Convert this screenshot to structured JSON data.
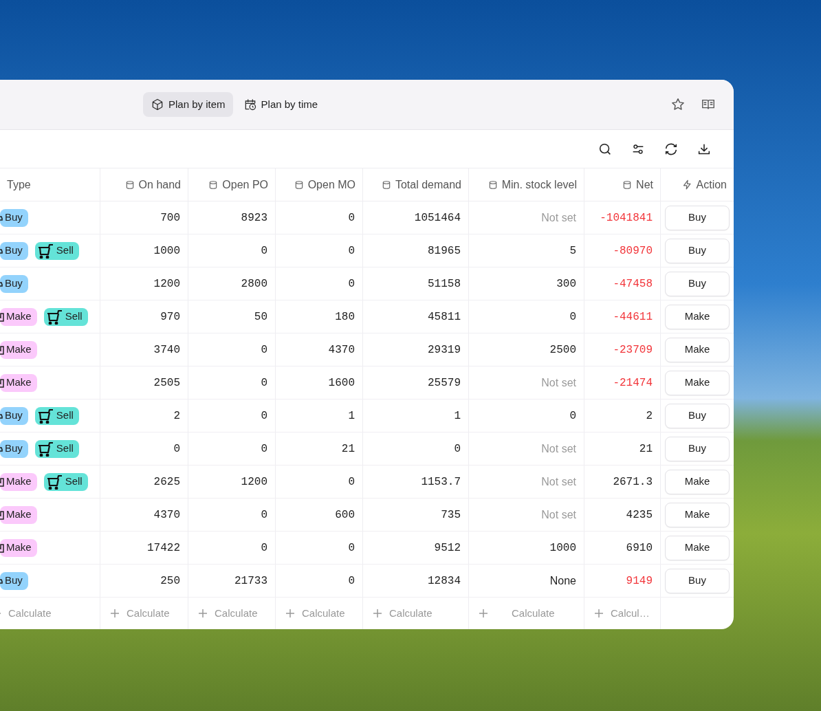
{
  "view_tabs": [
    {
      "label": "Plan by item",
      "kind": "item",
      "selected": true
    },
    {
      "label": "Plan by time",
      "kind": "time",
      "selected": false
    }
  ],
  "table": {
    "columns": [
      {
        "label": "Type",
        "kind": "type"
      },
      {
        "label": "On hand",
        "kind": "data"
      },
      {
        "label": "Open PO",
        "kind": "data"
      },
      {
        "label": "Open MO",
        "kind": "data"
      },
      {
        "label": "Total demand",
        "kind": "data"
      },
      {
        "label": "Min. stock level",
        "kind": "data"
      },
      {
        "label": "Net",
        "kind": "data"
      },
      {
        "label": "Action",
        "kind": "action"
      }
    ],
    "rows": [
      {
        "types": [
          {
            "kind": "buy",
            "label": "Buy"
          }
        ],
        "on_hand": "700",
        "open_po": "8923",
        "open_mo": "0",
        "total_demand": "1051464",
        "min_stock": "Not set",
        "min_stock_set": false,
        "net": "-1041841",
        "net_alert": true,
        "action": "Buy"
      },
      {
        "types": [
          {
            "kind": "buy",
            "label": "Buy"
          },
          {
            "kind": "sell",
            "label": "Sell"
          }
        ],
        "on_hand": "1000",
        "open_po": "0",
        "open_mo": "0",
        "total_demand": "81965",
        "min_stock": "5",
        "min_stock_set": true,
        "net": "-80970",
        "net_alert": true,
        "action": "Buy"
      },
      {
        "types": [
          {
            "kind": "buy",
            "label": "Buy"
          }
        ],
        "on_hand": "1200",
        "open_po": "2800",
        "open_mo": "0",
        "total_demand": "51158",
        "min_stock": "300",
        "min_stock_set": true,
        "net": "-47458",
        "net_alert": true,
        "action": "Buy"
      },
      {
        "types": [
          {
            "kind": "make",
            "label": "Make"
          },
          {
            "kind": "sell",
            "label": "Sell"
          }
        ],
        "on_hand": "970",
        "open_po": "50",
        "open_mo": "180",
        "total_demand": "45811",
        "min_stock": "0",
        "min_stock_set": true,
        "net": "-44611",
        "net_alert": true,
        "action": "Make"
      },
      {
        "types": [
          {
            "kind": "make",
            "label": "Make"
          }
        ],
        "on_hand": "3740",
        "open_po": "0",
        "open_mo": "4370",
        "total_demand": "29319",
        "min_stock": "2500",
        "min_stock_set": true,
        "net": "-23709",
        "net_alert": true,
        "action": "Make"
      },
      {
        "types": [
          {
            "kind": "make",
            "label": "Make"
          }
        ],
        "on_hand": "2505",
        "open_po": "0",
        "open_mo": "1600",
        "total_demand": "25579",
        "min_stock": "Not set",
        "min_stock_set": false,
        "net": "-21474",
        "net_alert": true,
        "action": "Make"
      },
      {
        "types": [
          {
            "kind": "buy",
            "label": "Buy"
          },
          {
            "kind": "sell",
            "label": "Sell"
          }
        ],
        "on_hand": "2",
        "open_po": "0",
        "open_mo": "1",
        "total_demand": "1",
        "min_stock": "0",
        "min_stock_set": true,
        "net": "2",
        "net_alert": false,
        "action": "Buy"
      },
      {
        "types": [
          {
            "kind": "buy",
            "label": "Buy"
          },
          {
            "kind": "sell",
            "label": "Sell"
          }
        ],
        "on_hand": "0",
        "open_po": "0",
        "open_mo": "21",
        "total_demand": "0",
        "min_stock": "Not set",
        "min_stock_set": false,
        "net": "21",
        "net_alert": false,
        "action": "Buy"
      },
      {
        "types": [
          {
            "kind": "make",
            "label": "Make"
          },
          {
            "kind": "sell",
            "label": "Sell"
          }
        ],
        "on_hand": "2625",
        "open_po": "1200",
        "open_mo": "0",
        "total_demand": "1153.7",
        "min_stock": "Not set",
        "min_stock_set": false,
        "net": "2671.3",
        "net_alert": false,
        "action": "Make"
      },
      {
        "types": [
          {
            "kind": "make",
            "label": "Make"
          }
        ],
        "on_hand": "4370",
        "open_po": "0",
        "open_mo": "600",
        "total_demand": "735",
        "min_stock": "Not set",
        "min_stock_set": false,
        "net": "4235",
        "net_alert": false,
        "action": "Make"
      },
      {
        "types": [
          {
            "kind": "make",
            "label": "Make"
          }
        ],
        "on_hand": "17422",
        "open_po": "0",
        "open_mo": "0",
        "total_demand": "9512",
        "min_stock": "1000",
        "min_stock_set": true,
        "net": "6910",
        "net_alert": false,
        "action": "Make"
      },
      {
        "types": [
          {
            "kind": "buy",
            "label": "Buy"
          }
        ],
        "on_hand": "250",
        "open_po": "21733",
        "open_mo": "0",
        "total_demand": "12834",
        "min_stock": "None",
        "min_stock_set": true,
        "net": "9149",
        "net_alert": true,
        "action": "Buy"
      }
    ],
    "footer": [
      "Calculate",
      "Calculate",
      "Calculate",
      "Calculate",
      "Calculate",
      "Calculate",
      "Calcul…"
    ]
  }
}
